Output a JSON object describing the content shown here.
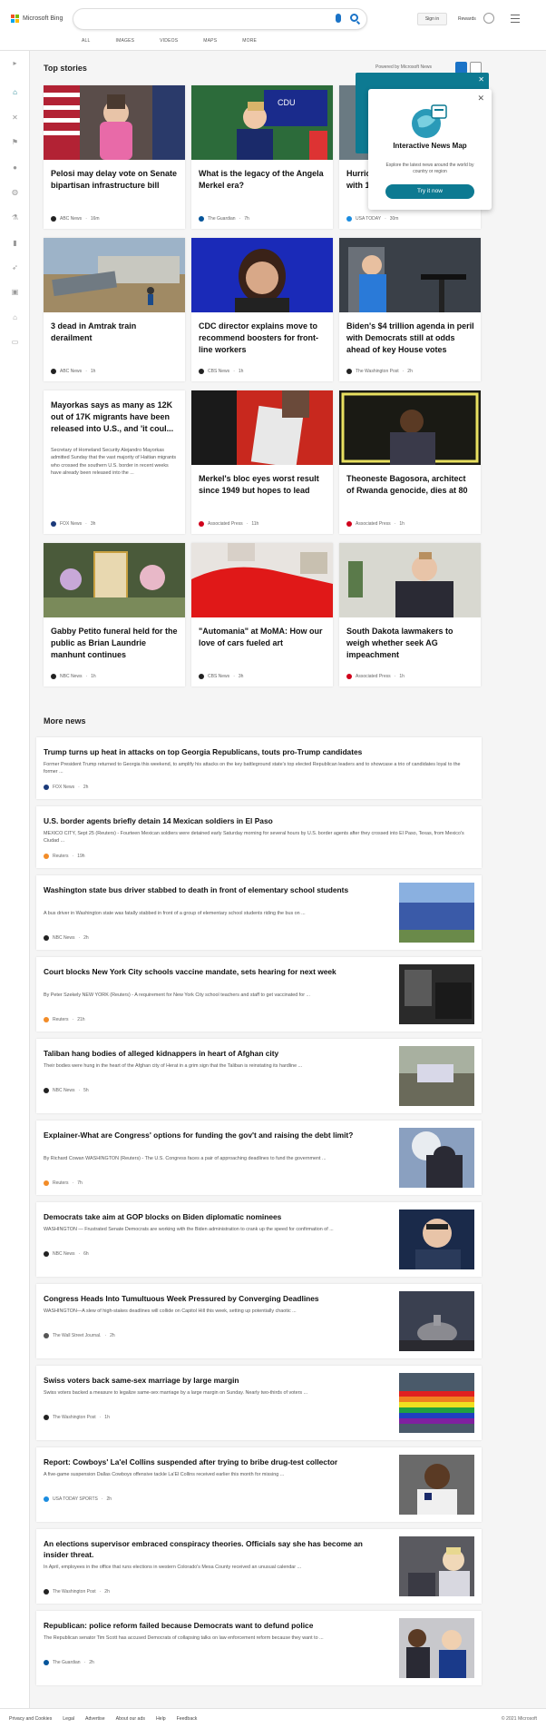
{
  "header": {
    "brand": "Microsoft Bing",
    "search_placeholder": "",
    "signin": "Sign in",
    "rewards": "Rewards",
    "tabs": [
      "ALL",
      "IMAGES",
      "VIDEOS",
      "MAPS",
      "MORE"
    ]
  },
  "sidebar": {
    "icons": [
      "chevron-right-icon",
      "home-icon",
      "sports-icon",
      "flag-icon",
      "location-icon",
      "world-icon",
      "science-icon",
      "business-icon",
      "rocket-icon",
      "entertainment-icon",
      "politics-icon",
      "money-icon"
    ]
  },
  "top_stories": {
    "title": "Top stories",
    "powered": "Powered by Microsoft News",
    "cards": [
      {
        "title": "Pelosi may delay vote on Senate bipartisan infrastructure bill",
        "source": "ABC News",
        "time": "16m",
        "src_color": "#222"
      },
      {
        "title": "What is the legacy of the Angela Merkel era?",
        "source": "The Guardian",
        "time": "7h",
        "src_color": "#05549a"
      },
      {
        "title": "Hurricane Sam now a Category 4 with 130 mph winds",
        "source": "USA TODAY",
        "time": "30m",
        "src_color": "#1a8ce0"
      },
      {
        "title": "3 dead in Amtrak train derailment",
        "source": "ABC News",
        "time": "1h",
        "src_color": "#222"
      },
      {
        "title": "CDC director explains move to recommend boosters for front-line workers",
        "source": "CBS News",
        "time": "1h",
        "src_color": "#222"
      },
      {
        "title": "Biden's $4 trillion agenda in peril with Democrats still at odds ahead of key House votes",
        "source": "The Washington Post",
        "time": "2h",
        "src_color": "#222"
      },
      {
        "title": "Mayorkas says as many as 12K out of 17K migrants have been released into U.S., and 'it coul...",
        "summary": "Secretary of Homeland Security Alejandro Mayorkas admitted Sunday that the vast majority of Haitian migrants who crossed the southern U.S. border in recent weeks have already been released into the ...",
        "source": "FOX News",
        "time": "3h",
        "src_color": "#1b3a7a"
      },
      {
        "title": "Merkel's bloc eyes worst result since 1949 but hopes to lead",
        "source": "Associated Press",
        "time": "11h",
        "src_color": "#d0021b"
      },
      {
        "title": "Theoneste Bagosora, architect of Rwanda genocide, dies at 80",
        "source": "Associated Press",
        "time": "1h",
        "src_color": "#d0021b"
      },
      {
        "title": "Gabby Petito funeral held for the public as Brian Laundrie manhunt continues",
        "source": "NBC News",
        "time": "1h",
        "src_color": "#222"
      },
      {
        "title": "\"Automania\" at MoMA: How our love of cars fueled art",
        "source": "CBS News",
        "time": "3h",
        "src_color": "#222"
      },
      {
        "title": "South Dakota lawmakers to weigh whether seek AG impeachment",
        "source": "Associated Press",
        "time": "1h",
        "src_color": "#d0021b"
      }
    ]
  },
  "popup": {
    "title": "Interactive News Map",
    "description": "Explore the latest news around the world by country or region",
    "button": "Try it now"
  },
  "more_news": {
    "title": "More news",
    "items": [
      {
        "title": "Trump turns up heat in attacks on top Georgia Republicans, touts pro-Trump candidates",
        "desc": "Former President Trump returned to Georgia this weekend, to amplify his attacks on the key battleground state's top elected Republican leaders and to showcase a trio of candidates loyal to the former ...",
        "source": "FOX News",
        "time": "2h",
        "src_color": "#1b3a7a"
      },
      {
        "title": "U.S. border agents briefly detain 14 Mexican soldiers in El Paso",
        "desc": "MEXICO CITY, Sept 25 (Reuters) - Fourteen Mexican soldiers were detained early Saturday morning for several hours by U.S. border agents after they crossed into El Paso, Texas, from Mexico's Ciudad ...",
        "source": "Reuters",
        "time": "19h",
        "src_color": "#f28c28"
      },
      {
        "title": "Washington state bus driver stabbed to death in front of elementary school students",
        "desc": "A bus driver in Washington state was fatally stabbed in front of a group of elementary school students riding the bus on ...",
        "source": "NBC News",
        "time": "2h",
        "src_color": "#222"
      },
      {
        "title": "Court blocks New York City schools vaccine mandate, sets hearing for next week",
        "desc": "By Peter Szekely NEW YORK (Reuters) - A requirement for New York City school teachers and staff to get vaccinated for ...",
        "source": "Reuters",
        "time": "21h",
        "src_color": "#f28c28"
      },
      {
        "title": "Taliban hang bodies of alleged kidnappers in heart of Afghan city",
        "desc": "Their bodies were hung in the heart of the Afghan city of Herat in a grim sign that the Taliban is reinstating its hardline ...",
        "source": "NBC News",
        "time": "5h",
        "src_color": "#222"
      },
      {
        "title": "Explainer-What are Congress' options for funding the gov't and raising the debt limit?",
        "desc": "By Richard Cowan WASHINGTON (Reuters) - The U.S. Congress faces a pair of approaching deadlines to fund the government ...",
        "source": "Reuters",
        "time": "7h",
        "src_color": "#f28c28"
      },
      {
        "title": "Democrats take aim at GOP blocks on Biden diplomatic nominees",
        "desc": "WASHINGTON — Frustrated Senate Democrats are working with the Biden administration to crank up the speed for confirmation of ...",
        "source": "NBC News",
        "time": "6h",
        "src_color": "#222"
      },
      {
        "title": "Congress Heads Into Tumultuous Week Pressured by Converging Deadlines",
        "desc": "WASHINGTON—A slew of high-stakes deadlines will collide on Capitol Hill this week, setting up potentially chaotic ...",
        "source": "The Wall Street Journal.",
        "time": "2h",
        "src_color": "#555"
      },
      {
        "title": "Swiss voters back same-sex marriage by large margin",
        "desc": "Swiss voters backed a measure to legalize same-sex marriage by a large margin on Sunday. Nearly two-thirds of voters ...",
        "source": "The Washington Post",
        "time": "1h",
        "src_color": "#222"
      },
      {
        "title": "Report: Cowboys' La'el Collins suspended after trying to bribe drug-test collector",
        "desc": "A five-game suspension Dallas Cowboys offensive tackle La'El Collins received earlier this month for missing ...",
        "source": "USA TODAY SPORTS",
        "time": "2h",
        "src_color": "#1a8ce0"
      },
      {
        "title": "An elections supervisor embraced conspiracy theories. Officials say she has become an insider threat.",
        "desc": "In April, employees in the office that runs elections in western Colorado's Mesa County received an unusual calendar ...",
        "source": "The Washington Post",
        "time": "2h",
        "src_color": "#222"
      },
      {
        "title": "Republican: police reform failed because Democrats want to defund police",
        "desc": "The Republican senator Tim Scott has accused Democrats of collapsing talks on law enforcement reform because they want to ...",
        "source": "The Guardian",
        "time": "2h",
        "src_color": "#05549a"
      }
    ]
  },
  "footer": {
    "links": [
      "Privacy and Cookies",
      "Legal",
      "Advertise",
      "About our ads",
      "Help",
      "Feedback"
    ],
    "copyright": "© 2021 Microsoft"
  }
}
